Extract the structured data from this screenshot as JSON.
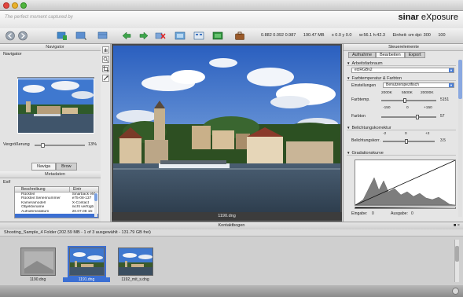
{
  "window": {
    "tagline": "The perfect moment captured by",
    "brand_bold": "sinar",
    "brand_rest": " eXposure"
  },
  "toolbar": {
    "readout": [
      "0.882 0.092 0.987",
      "190.47 MB",
      "x 0.0 y 0.0",
      "w:56.1 h:42.3",
      "Einheit: cm dpi: 300",
      "100"
    ]
  },
  "navigator": {
    "title": "Navigator",
    "zoom_label": "Vergrößerung",
    "zoom_value": "13%",
    "zoom_fraction": 0.13,
    "tabs": [
      "Naviga",
      "Brow"
    ]
  },
  "metadata": {
    "title": "Metadaten",
    "exif_label": "Exif",
    "col_desc": "Beschreibung",
    "col_entry": "Eintr",
    "rows": [
      {
        "desc": "Rückteil",
        "entry": "Sinarback eM"
      },
      {
        "desc": "Rückteil Seriennummer",
        "entry": "e75-08-137"
      },
      {
        "desc": "Kameramodell",
        "entry": "X-Contact"
      },
      {
        "desc": "Objektivname",
        "entry": "nicht verfügb"
      },
      {
        "desc": "Aufnahmedatum",
        "entry": "20.07.08 16:"
      },
      {
        "desc": "",
        "entry": ""
      }
    ]
  },
  "main": {
    "caption": "1190.dng"
  },
  "control": {
    "title": "Steuerelemente",
    "tabs": [
      "Aufnahme",
      "Bearbeiten",
      "Export"
    ],
    "arbeitsfarbraum": "Arbeitsfarbraum",
    "colorspace": "eciRGBv2",
    "farbtemp": "Farbtemperatur & Farbton",
    "einstellungen_label": "Einstellungen",
    "einstellungen_value": "Benutzerspezifisch",
    "temp_ticks": [
      "2000K",
      "5500K",
      "20000K"
    ],
    "farbtemp_label": "Farbtemp.",
    "farbtemp_value": "5151",
    "tint_ticks": [
      "-150",
      "0",
      "+150"
    ],
    "farbton_label": "Farbton",
    "farbton_value": "57",
    "belichtung": "Belichtungskorrektur",
    "exp_ticks": [
      "-2",
      "0",
      "+2"
    ],
    "exp_label": "Belichtungskorr.",
    "exp_value": "3.5",
    "grad": "Gradationskurve",
    "eingabe_label": "Eingabe:",
    "eingabe_value": "0",
    "ausgabe_label": "Ausgabe:",
    "ausgabe_value": "0"
  },
  "filmstrip": {
    "title": "Kontaktbogen",
    "info": "Shooting_Sample_4 Folder (202.59 MB - 1 of 3 ausgewählt - 131.79 GB frei)",
    "thumbs": [
      {
        "name": "1190.dng"
      },
      {
        "name": "1191.dng"
      },
      {
        "name": "1192_mit_s.dng"
      }
    ]
  },
  "colors": {
    "selection": "#3b6fd3",
    "sky": "#2f66c6",
    "water": "#3b4c5e"
  },
  "icons": [
    "back-icon",
    "forward-icon",
    "import-icon",
    "layout-icon",
    "view-icon",
    "arrow-left-icon",
    "arrow-right-icon",
    "delete-icon",
    "compare-icon",
    "grid-icon",
    "display-icon",
    "briefcase-icon",
    "hand-icon",
    "zoom-icon",
    "crop-icon",
    "eyedropper-icon"
  ]
}
